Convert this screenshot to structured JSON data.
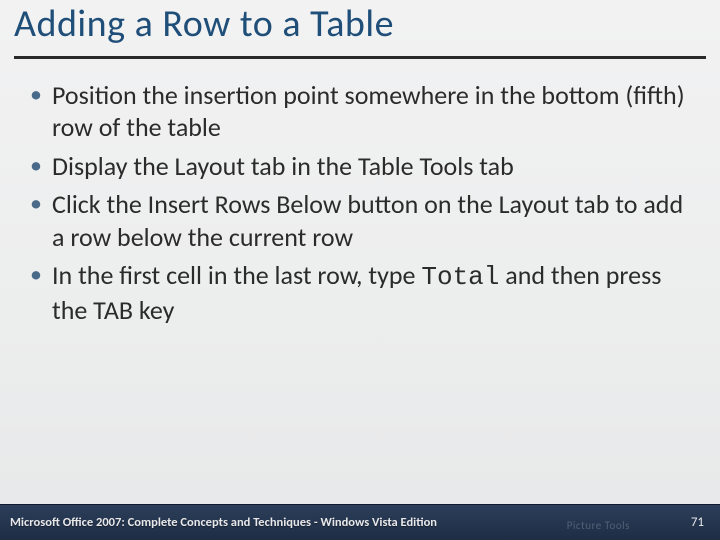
{
  "title": "Adding a Row to a Table",
  "bullets": [
    {
      "text": "Position the insertion point somewhere in the bottom (fifth) row of the table"
    },
    {
      "text": "Display the Layout tab in the Table Tools tab"
    },
    {
      "text": "Click the Insert Rows Below button on the Layout tab to add a row below the current row"
    },
    {
      "prefix": "In the first cell in the last row, type ",
      "code": "Total",
      "suffix": " and then press the TAB key"
    }
  ],
  "footer": {
    "text": "Microsoft Office 2007: Complete Concepts and Techniques - Windows Vista Edition",
    "ghost": "Picture Tools",
    "page": "71"
  }
}
